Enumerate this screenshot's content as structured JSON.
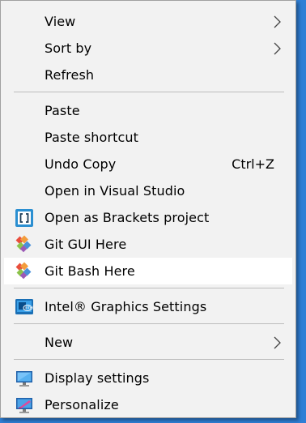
{
  "menu": {
    "items": [
      {
        "label": "View"
      },
      {
        "label": "Sort by"
      },
      {
        "label": "Refresh"
      },
      {
        "label": "Paste"
      },
      {
        "label": "Paste shortcut"
      },
      {
        "label": "Undo Copy",
        "shortcut": "Ctrl+Z"
      },
      {
        "label": "Open in Visual Studio"
      },
      {
        "label": "Open as Brackets project"
      },
      {
        "label": "Git GUI Here"
      },
      {
        "label": "Git Bash Here"
      },
      {
        "label": "Intel® Graphics Settings"
      },
      {
        "label": "New"
      },
      {
        "label": "Display settings"
      },
      {
        "label": "Personalize"
      }
    ]
  },
  "icons": {
    "brackets": "brackets-icon",
    "git_gui": "git-icon",
    "git_bash": "git-icon",
    "intel": "intel-graphics-icon",
    "display": "display-monitor-icon",
    "personalize": "personalize-monitor-icon",
    "submenu": "chevron-right-icon"
  },
  "colors": {
    "desktop": "#2f7fd6",
    "menu_bg": "#f2f2f2",
    "hover_bg": "#ffffff",
    "separator": "#bdbdbd"
  }
}
